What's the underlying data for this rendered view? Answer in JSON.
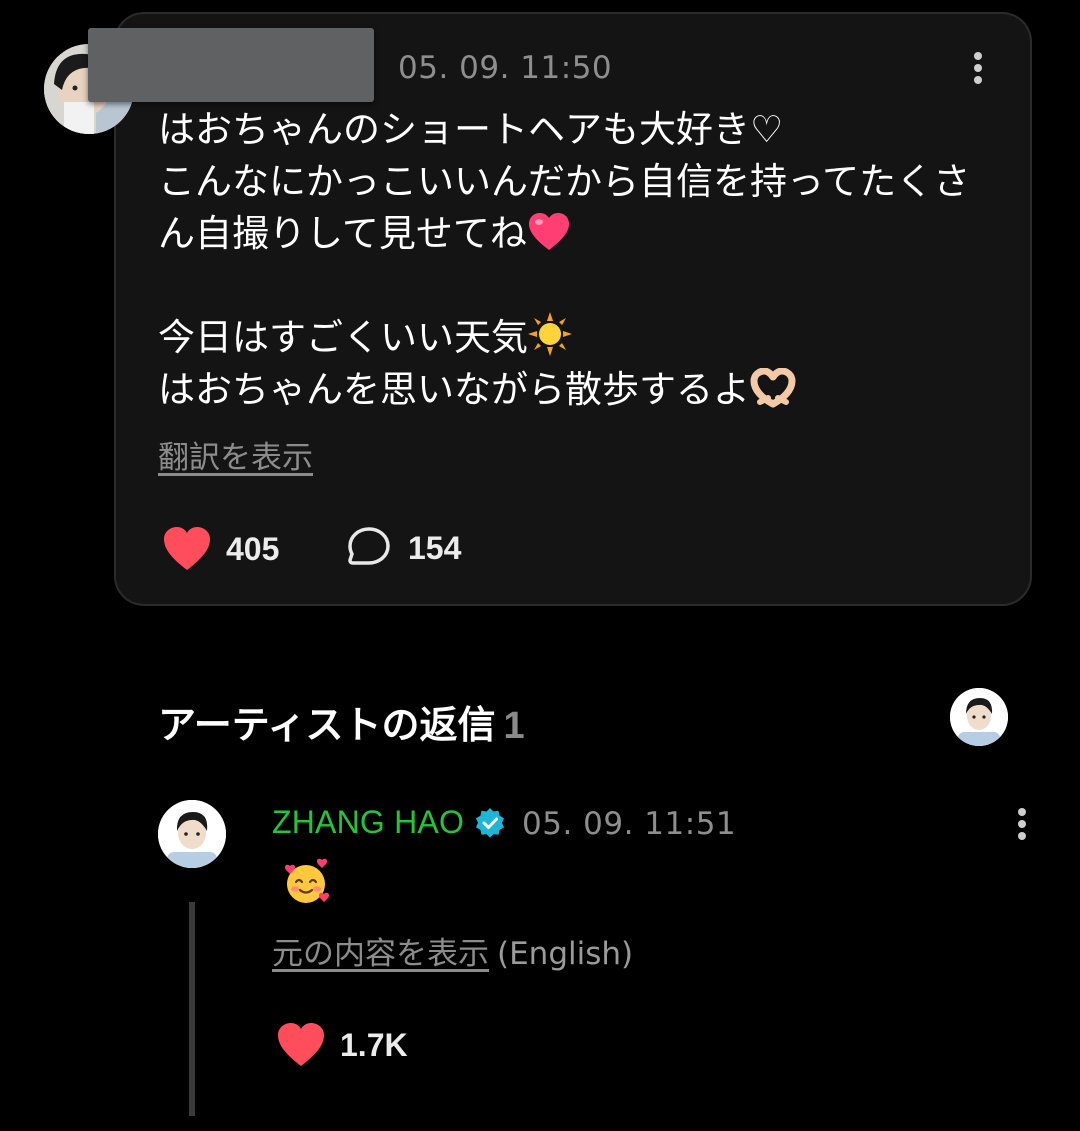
{
  "colors": {
    "background": "#000000",
    "card": "#141414",
    "like_red": "#ff4d5c",
    "artist_name_green": "#25c53a",
    "verified_blue": "#1eb6d6",
    "muted_text": "#8e8e8e"
  },
  "post": {
    "timestamp": "05. 09. 11:50",
    "body_lines": [
      "はおちゃんのショートヘアも大好き♡",
      "こんなにかっこいいんだから自信を持ってたくさ",
      "ん自撮りして見せてね",
      "今日はすごくいい天気",
      "はおちゃんを思いながら散歩するよ"
    ],
    "translate_link": "翻訳を表示",
    "like_count": "405",
    "comment_count": "154",
    "icons": {
      "like": "heart-icon",
      "comment": "comment-bubble-icon",
      "menu": "more-vertical-icon"
    }
  },
  "artist_replies": {
    "title": "アーティストの返信",
    "count": "1",
    "reply": {
      "name": "ZHANG HAO",
      "timestamp": "05. 09. 11:51",
      "show_original_link": "元の内容を表示",
      "original_language": "(English)",
      "like_count": "1.7K",
      "icons": {
        "verified": "verified-badge-icon",
        "body_emoji": "smiling-face-with-hearts-icon",
        "like": "heart-icon",
        "menu": "more-vertical-icon"
      }
    }
  }
}
